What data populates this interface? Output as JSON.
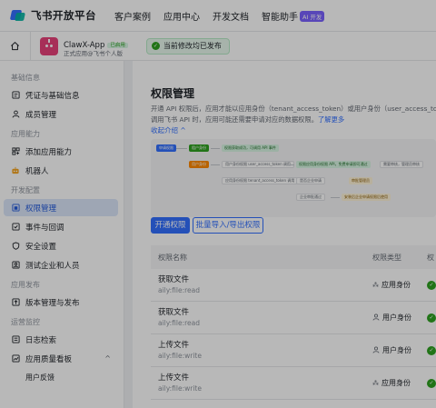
{
  "topbar": {
    "logo_text": "飞书开放平台",
    "nav": [
      "客户案例",
      "应用中心",
      "开发文档",
      "智能助手"
    ],
    "ai_badge": "AI 开发"
  },
  "appbar": {
    "app_name": "ClawX-App",
    "app_tag": "已启用",
    "app_subtitle": "正式应用@飞书个人版",
    "publish_status": "当前修改均已发布"
  },
  "sidebar": {
    "sections": [
      {
        "title": "基础信息",
        "items": [
          {
            "label": "凭证与基础信息",
            "icon": "credentials-icon"
          },
          {
            "label": "成员管理",
            "icon": "member-icon"
          }
        ]
      },
      {
        "title": "应用能力",
        "items": [
          {
            "label": "添加应用能力",
            "icon": "add-capability-icon"
          },
          {
            "label": "机器人",
            "icon": "robot-icon"
          }
        ]
      },
      {
        "title": "开发配置",
        "items": [
          {
            "label": "权限管理",
            "icon": "permission-icon",
            "active": true
          },
          {
            "label": "事件与回调",
            "icon": "event-icon"
          },
          {
            "label": "安全设置",
            "icon": "security-icon"
          },
          {
            "label": "测试企业和人员",
            "icon": "test-users-icon"
          }
        ]
      },
      {
        "title": "应用发布",
        "items": [
          {
            "label": "版本管理与发布",
            "icon": "version-icon"
          }
        ]
      },
      {
        "title": "运营监控",
        "items": [
          {
            "label": "日志检索",
            "icon": "log-icon"
          },
          {
            "label": "应用质量看板",
            "icon": "dashboard-icon"
          },
          {
            "label": "用户反馈",
            "icon": ""
          }
        ]
      }
    ]
  },
  "main": {
    "title": "权限管理",
    "desc_line1": "开通 API 权限后，应用才能以应用身份（tenant_access_token）或用户身份（user_access_tok",
    "desc_line2_pre": "调用飞书 API 时，应用可能还需要申请对应的数据权限。",
    "desc_link": "了解更多",
    "collapse_label": "收起介绍 ^",
    "flow": {
      "apply_perm": "申请权限",
      "tenant_identity": "租户身份",
      "apply_api_perm": "权限获取成功，可调用 API 事件",
      "user_identity": "用户身份",
      "user_token": "用户身份权限 user_access_token 调用",
      "tenant_token": "应用身份权限 tenant_access_token 调用",
      "perm_ok": "权限应用身份权限 API，免费申请即可通过",
      "enterprise_admin": "是否企业申请",
      "passed": "审批管理员",
      "need_review": "需要审核，管理员审核",
      "review_done": "企业审批通过",
      "can_use": "安装后企业申请权限后使用"
    },
    "buttons": {
      "enable": "开通权限",
      "batch": "批量导入/导出权限"
    },
    "table": {
      "col_name": "权限名称",
      "col_type": "权限类型",
      "col_status": "权",
      "rows": [
        {
          "name": "获取文件",
          "scope": "aily:file:read",
          "type": "应用身份",
          "type_icon": "app-identity-icon"
        },
        {
          "name": "获取文件",
          "scope": "aily:file:read",
          "type": "用户身份",
          "type_icon": "user-identity-icon"
        },
        {
          "name": "上传文件",
          "scope": "aily:file:write",
          "type": "用户身份",
          "type_icon": "user-identity-icon"
        },
        {
          "name": "上传文件",
          "scope": "aily:file:write",
          "type": "应用身份",
          "type_icon": "app-identity-icon"
        }
      ]
    }
  }
}
